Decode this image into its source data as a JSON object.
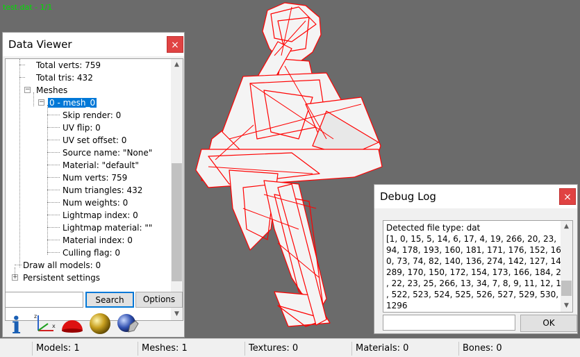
{
  "app": {
    "overlay_title": "test.dat - 1/1"
  },
  "data_viewer": {
    "title": "Data Viewer",
    "close_label": "×",
    "tree": {
      "total_verts": "Total verts: 759",
      "total_tris": "Total tris: 432",
      "meshes": "Meshes",
      "mesh_0": "0 - mesh_0",
      "skip_render": "Skip render: 0",
      "uv_flip": "UV flip: 0",
      "uv_set_offset": "UV set offset: 0",
      "source_name": "Source name: \"None\"",
      "material": "Material: \"default\"",
      "num_verts": "Num verts: 759",
      "num_triangles": "Num triangles: 432",
      "num_weights": "Num weights: 0",
      "lightmap_index": "Lightmap index: 0",
      "lightmap_material": "Lightmap material: \"\"",
      "material_index": "Material index: 0",
      "culling_flag": "Culling flag: 0",
      "draw_all_models": "Draw all models: 0",
      "persistent_settings": "Persistent settings"
    },
    "search_value": "",
    "search_label": "Search",
    "options_label": "Options"
  },
  "toolbar": {
    "icons": [
      "info-icon",
      "axes-icon",
      "dome-icon",
      "sphere-icon",
      "globe-hand-icon"
    ]
  },
  "debug_log": {
    "title": "Debug Log",
    "close_label": "×",
    "lines": [
      "Detected file type: dat",
      "[1, 0, 15, 5, 14, 6, 17, 4, 19, 266, 20, 23,",
      "94, 178, 193, 160, 181, 171, 176, 152, 16",
      "0, 73, 74, 82, 140, 136, 274, 142, 127, 14",
      "289, 170, 150, 172, 154, 173, 166, 184, 2",
      ", 22, 23, 25, 266, 13, 34, 7, 8, 9, 11, 12, 1",
      ", 522, 523, 524, 525, 526, 527, 529, 530,",
      "1296"
    ],
    "input_value": "",
    "ok_label": "OK"
  },
  "status_bar": {
    "models": "Models: 1",
    "meshes": "Meshes: 1",
    "textures": "Textures: 0",
    "materials": "Materials: 0",
    "bones": "Bones: 0"
  },
  "colors": {
    "background": "#6b6b6b",
    "wireframe": "#ff0000",
    "overlay_text": "#00e000",
    "selection": "#0078d7"
  }
}
